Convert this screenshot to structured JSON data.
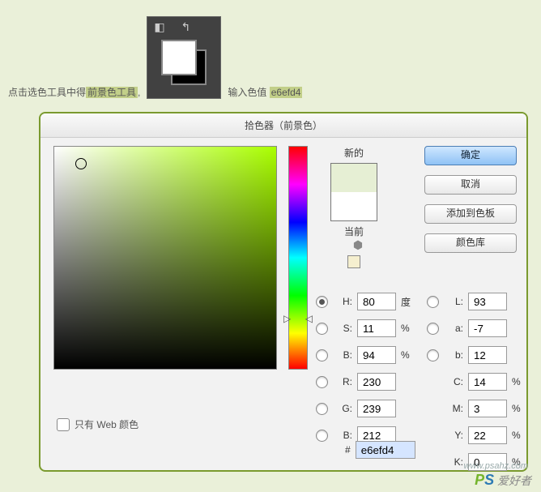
{
  "instruction": {
    "part1": "点击选色工具中得",
    "h1": "前景色工具",
    "part2": ",",
    "part3": "输入色值",
    "h2": "e6efd4"
  },
  "picker": {
    "title": "拾色器（前景色）",
    "new_label": "新的",
    "current_label": "当前",
    "buttons": {
      "ok": "确定",
      "cancel": "取消",
      "add_swatch": "添加到色板",
      "libraries": "颜色库"
    },
    "labels": {
      "H": "H:",
      "S": "S:",
      "B": "B:",
      "R": "R:",
      "G": "G:",
      "B2": "B:",
      "L": "L:",
      "a": "a:",
      "b": "b:",
      "C": "C:",
      "M": "M:",
      "Y": "Y:",
      "K": "K:"
    },
    "units": {
      "deg": "度",
      "pct": "%"
    },
    "values": {
      "H": "80",
      "S": "11",
      "Bv": "94",
      "R": "230",
      "G": "239",
      "Bc": "212",
      "L": "93",
      "a": "-7",
      "b": "12",
      "C": "14",
      "M": "3",
      "Y": "22",
      "K": "0",
      "hex": "e6efd4"
    },
    "hex_prefix": "#",
    "web_only": "只有 Web 颜色"
  },
  "watermark": {
    "p": "P",
    "s": "S",
    "rest": " 爱好者",
    "url": "www.psahz.com"
  }
}
